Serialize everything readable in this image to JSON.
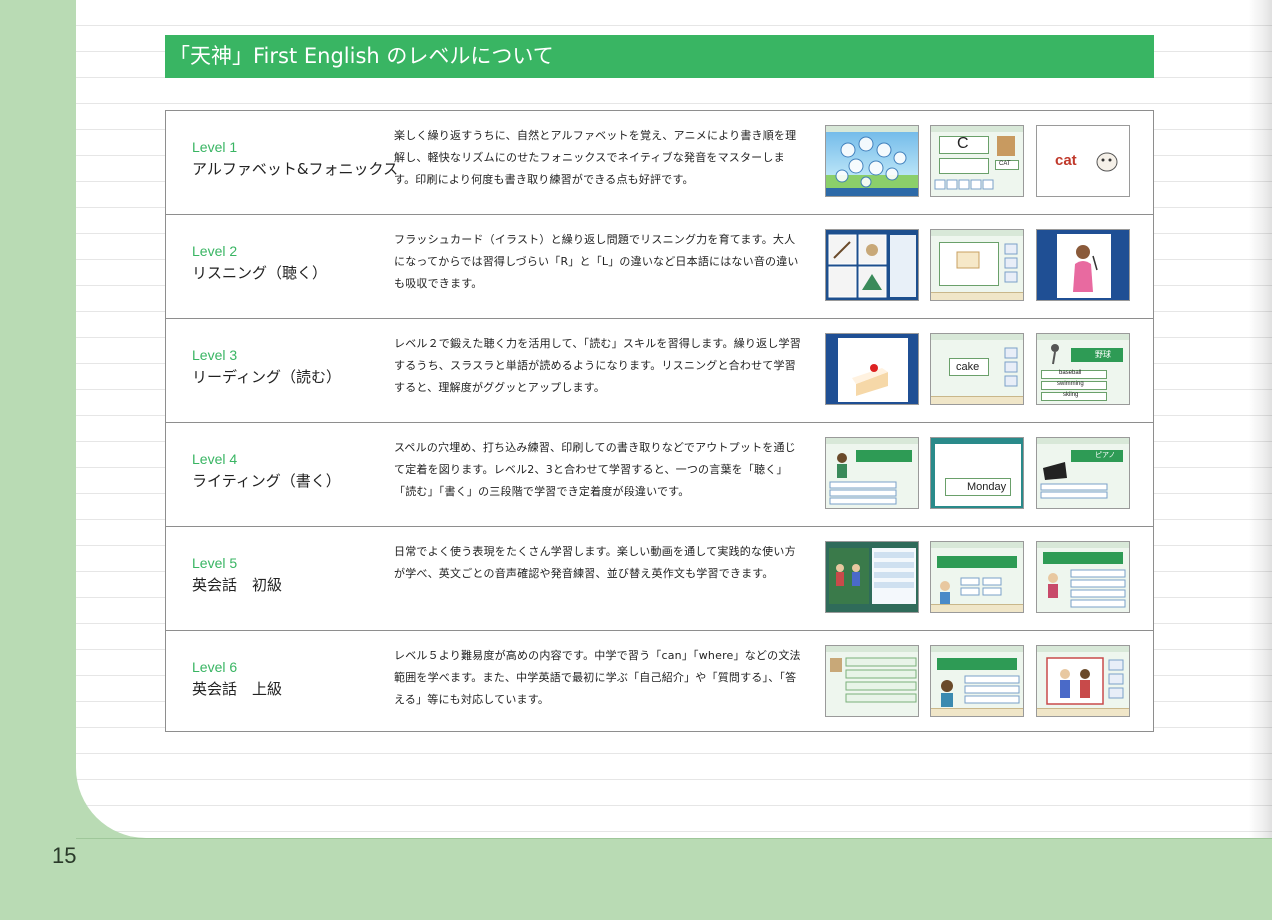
{
  "page_number": "15",
  "title": "「天神」First English のレベルについて",
  "levels": [
    {
      "num": "Level 1",
      "name": "アルファベット&フォニックス",
      "desc": "楽しく繰り返すうちに、自然とアルファベットを覚え、アニメにより書き順を理解し、軽快なリズムにのせたフォニックスでネイティブな発音をマスターします。印刷により何度も書き取り練習ができる点も好評です。",
      "thumb_words": [
        "C",
        "CAT",
        "cat"
      ]
    },
    {
      "num": "Level 2",
      "name": "リスニング（聴く）",
      "desc": "フラッシュカード（イラスト）と繰り返し問題でリスニング力を育てます。大人になってからでは習得しづらい「R」と「L」の違いなど日本語にはない音の違いも吸収できます。",
      "thumb_words": []
    },
    {
      "num": "Level 3",
      "name": "リーディング（読む）",
      "desc": "レベル２で鍛えた聴く力を活用して、「読む」スキルを習得します。繰り返し学習するうち、スラスラと単語が読めるようになります。リスニングと合わせて学習すると、理解度がググッとアップします。",
      "thumb_words": [
        "cake",
        "野球",
        "baseball",
        "swimming",
        "skiing"
      ]
    },
    {
      "num": "Level 4",
      "name": "ライティング（書く）",
      "desc": "スペルの穴埋め、打ち込み練習、印刷しての書き取りなどでアウトプットを通じて定着を図ります。レベル2、3と合わせて学習すると、一つの言葉を「聴く」「読む」「書く」の三段階で学習でき定着度が段違いです。",
      "thumb_words": [
        "Monday",
        "ピアノ"
      ]
    },
    {
      "num": "Level 5",
      "name": "英会話　初級",
      "desc": "日常でよく使う表現をたくさん学習します。楽しい動画を通して実践的な使い方が学べ、英文ごとの音声確認や発音練習、並び替え英作文も学習できます。",
      "thumb_words": []
    },
    {
      "num": "Level 6",
      "name": "英会話　上級",
      "desc": "レベル５より難易度が高めの内容です。中学で習う「can」「where」などの文法範囲を学べます。また、中学英語で最初に学ぶ「自己紹介」や「質問する」、「答える」等にも対応しています。",
      "thumb_words": []
    }
  ]
}
